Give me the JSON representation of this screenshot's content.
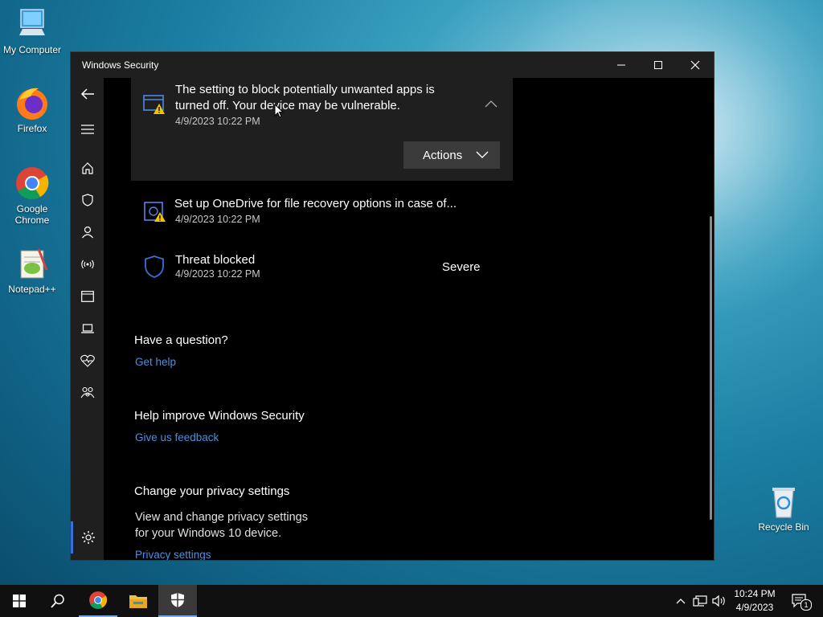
{
  "desktop": {
    "icons": [
      {
        "label": "My Computer"
      },
      {
        "label": "Firefox"
      },
      {
        "label": "Google Chrome"
      },
      {
        "label": "Notepad++"
      },
      {
        "label": "Recycle Bin"
      }
    ]
  },
  "window": {
    "title": "Windows Security"
  },
  "notifications": [
    {
      "title": "The setting to block potentially unwanted apps is turned off. Your device may be vulnerable.",
      "date": "4/9/2023 10:22 PM",
      "action_label": "Actions"
    },
    {
      "title": "Set up OneDrive for file recovery options in case of...",
      "date": "4/9/2023 10:22 PM"
    },
    {
      "title": "Threat blocked",
      "date": "4/9/2023 10:22 PM",
      "severity": "Severe"
    }
  ],
  "help": {
    "heading": "Have a question?",
    "link": "Get help"
  },
  "feedback": {
    "heading": "Help improve Windows Security",
    "link": "Give us feedback"
  },
  "privacy": {
    "heading": "Change your privacy settings",
    "text_line1": "View and change privacy settings",
    "text_line2": "for your Windows 10 device.",
    "link": "Privacy settings"
  },
  "taskbar": {
    "time": "10:24 PM",
    "date": "4/9/2023",
    "notification_count": "1"
  },
  "colors": {
    "link": "#4c8fe0",
    "shield_accent": "#3a6fd8",
    "warning": "#f5c400"
  }
}
